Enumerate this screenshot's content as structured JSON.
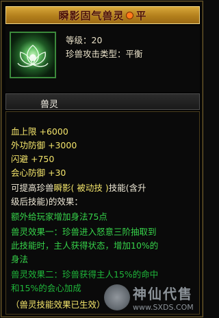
{
  "title": {
    "name": "瞬影固气兽灵",
    "suffix": "平",
    "dot_color": "#ff7a1a"
  },
  "header": {
    "icon": "green-lotus-icon",
    "level_line": "等级：20",
    "type_line": "珍兽攻击类型：平衡"
  },
  "section_tab": "兽灵",
  "stats": [
    {
      "label": "血上限",
      "value": "+6000"
    },
    {
      "label": "外功防御",
      "value": "+3000"
    },
    {
      "label": "闪避",
      "value": "+750"
    },
    {
      "label": "会心防御",
      "value": "+30"
    }
  ],
  "description": {
    "line1_prefix": "可提高珍兽",
    "line1_skill": "瞬影",
    "line1_passive": "( 被动技 )",
    "line1_rest": "技能(含升",
    "line2": "级后技能)的效果：",
    "bonus": "额外给玩家增加身法75点",
    "effect1_a": "兽灵效果一：珍兽进入怒意三阶抽取到",
    "effect1_b": "此技能时，主人获得状态，增加10%的",
    "effect1_c": "身法",
    "effect2_a": "兽灵效果二：珍兽获得主人15%的命中",
    "effect2_b": "和15%的会心加成",
    "active": "（兽灵技能效果已生效）"
  },
  "watermark": {
    "big": "神仙代售",
    "small": "www.SXDS.COM"
  }
}
